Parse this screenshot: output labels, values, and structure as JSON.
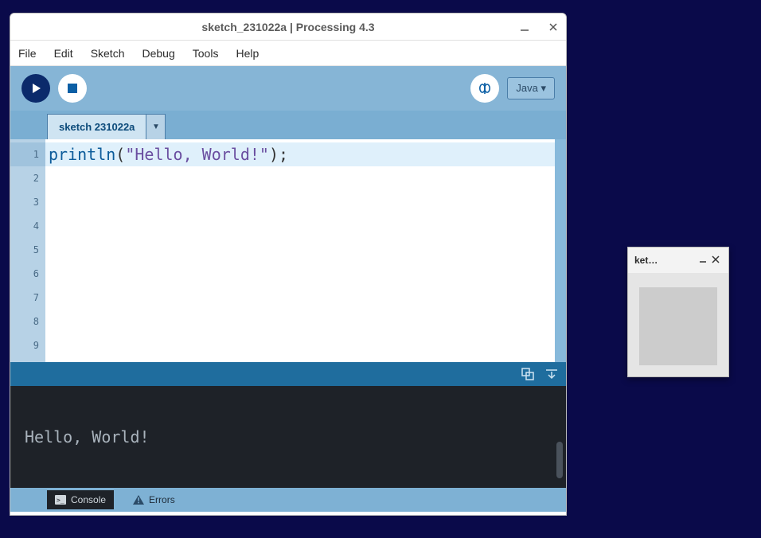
{
  "window": {
    "title": "sketch_231022a | Processing 4.3"
  },
  "menu": {
    "file": "File",
    "edit": "Edit",
    "sketch": "Sketch",
    "debug": "Debug",
    "tools": "Tools",
    "help": "Help"
  },
  "toolbar": {
    "mode_label": "Java ▾"
  },
  "tabs": {
    "main": "sketch 231022a"
  },
  "code": {
    "line1_fn": "println",
    "line1_open": "(",
    "line1_str": "\"Hello, World!\"",
    "line1_close": ");"
  },
  "gutter": [
    "1",
    "2",
    "3",
    "4",
    "5",
    "6",
    "7",
    "8",
    "9"
  ],
  "console": {
    "output": "Hello, World!"
  },
  "bottom": {
    "console": "Console",
    "errors": "Errors"
  },
  "sketch_window": {
    "title": "ket…"
  }
}
